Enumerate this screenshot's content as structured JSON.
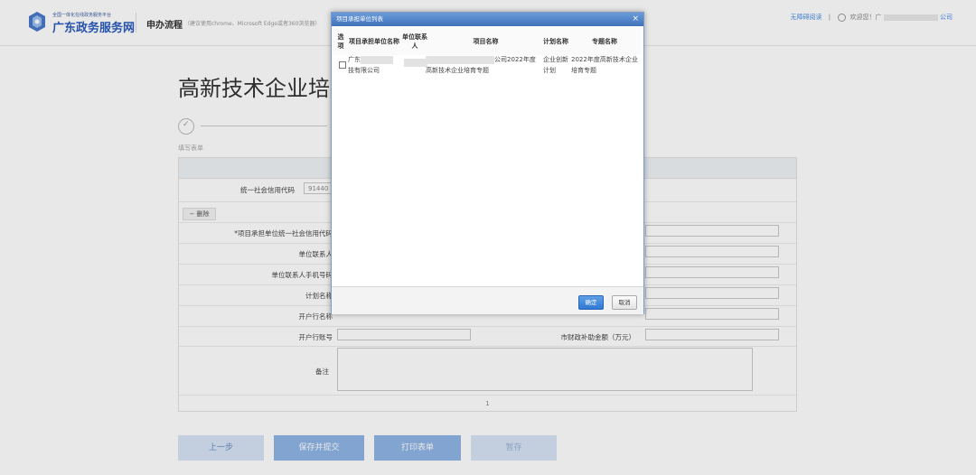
{
  "header": {
    "logo_sub": "全国一体化在线政务服务平台",
    "logo_main": "广东政务服务网",
    "flow_title": "申办流程",
    "browser_tip": "（建议使用chrome、Microsoft Edge或者360浏览器）",
    "accessibility_link": "无障碍阅读",
    "divider": "|",
    "welcome": "欢迎您！广",
    "welcome_suffix": "公司"
  },
  "page": {
    "title": "高新技术企业培",
    "step_label": "填写表单"
  },
  "form": {
    "credit_code_label": "统一社会信用代码",
    "credit_code_value": "91440",
    "delete_button": "删除",
    "project_code_label": "*项目承担单位统一社会信用代码",
    "contact_label": "单位联系人",
    "phone_label": "单位联系人手机号码",
    "plan_label": "计划名称",
    "bank_label": "开户行名称",
    "account_label": "开户行账号",
    "subsidy_label": "市财政补助金额（万元）",
    "remark_label": "备注",
    "page_number": "1"
  },
  "buttons": {
    "prev": "上一步",
    "save_submit": "保存并提交",
    "print": "打印表单",
    "temp_save": "暂存"
  },
  "dialog": {
    "title": "项目承担单位列表",
    "close": "×",
    "columns": {
      "select": "选项",
      "unit_name": "项目承担单位名称",
      "contact": "单位联系人",
      "project_name": "项目名称",
      "plan_name": "计划名称",
      "topic_name": "专题名称"
    },
    "row": {
      "unit_name_prefix": "广东",
      "unit_name_suffix": "技有限公司",
      "project_suffix": "公司2022年度",
      "project_line2": "高新技术企业培育专题",
      "plan_name": "企业创新计划",
      "topic_name": "2022年度高新技术企业培育专题"
    },
    "ok": "确定",
    "cancel": "取消"
  }
}
